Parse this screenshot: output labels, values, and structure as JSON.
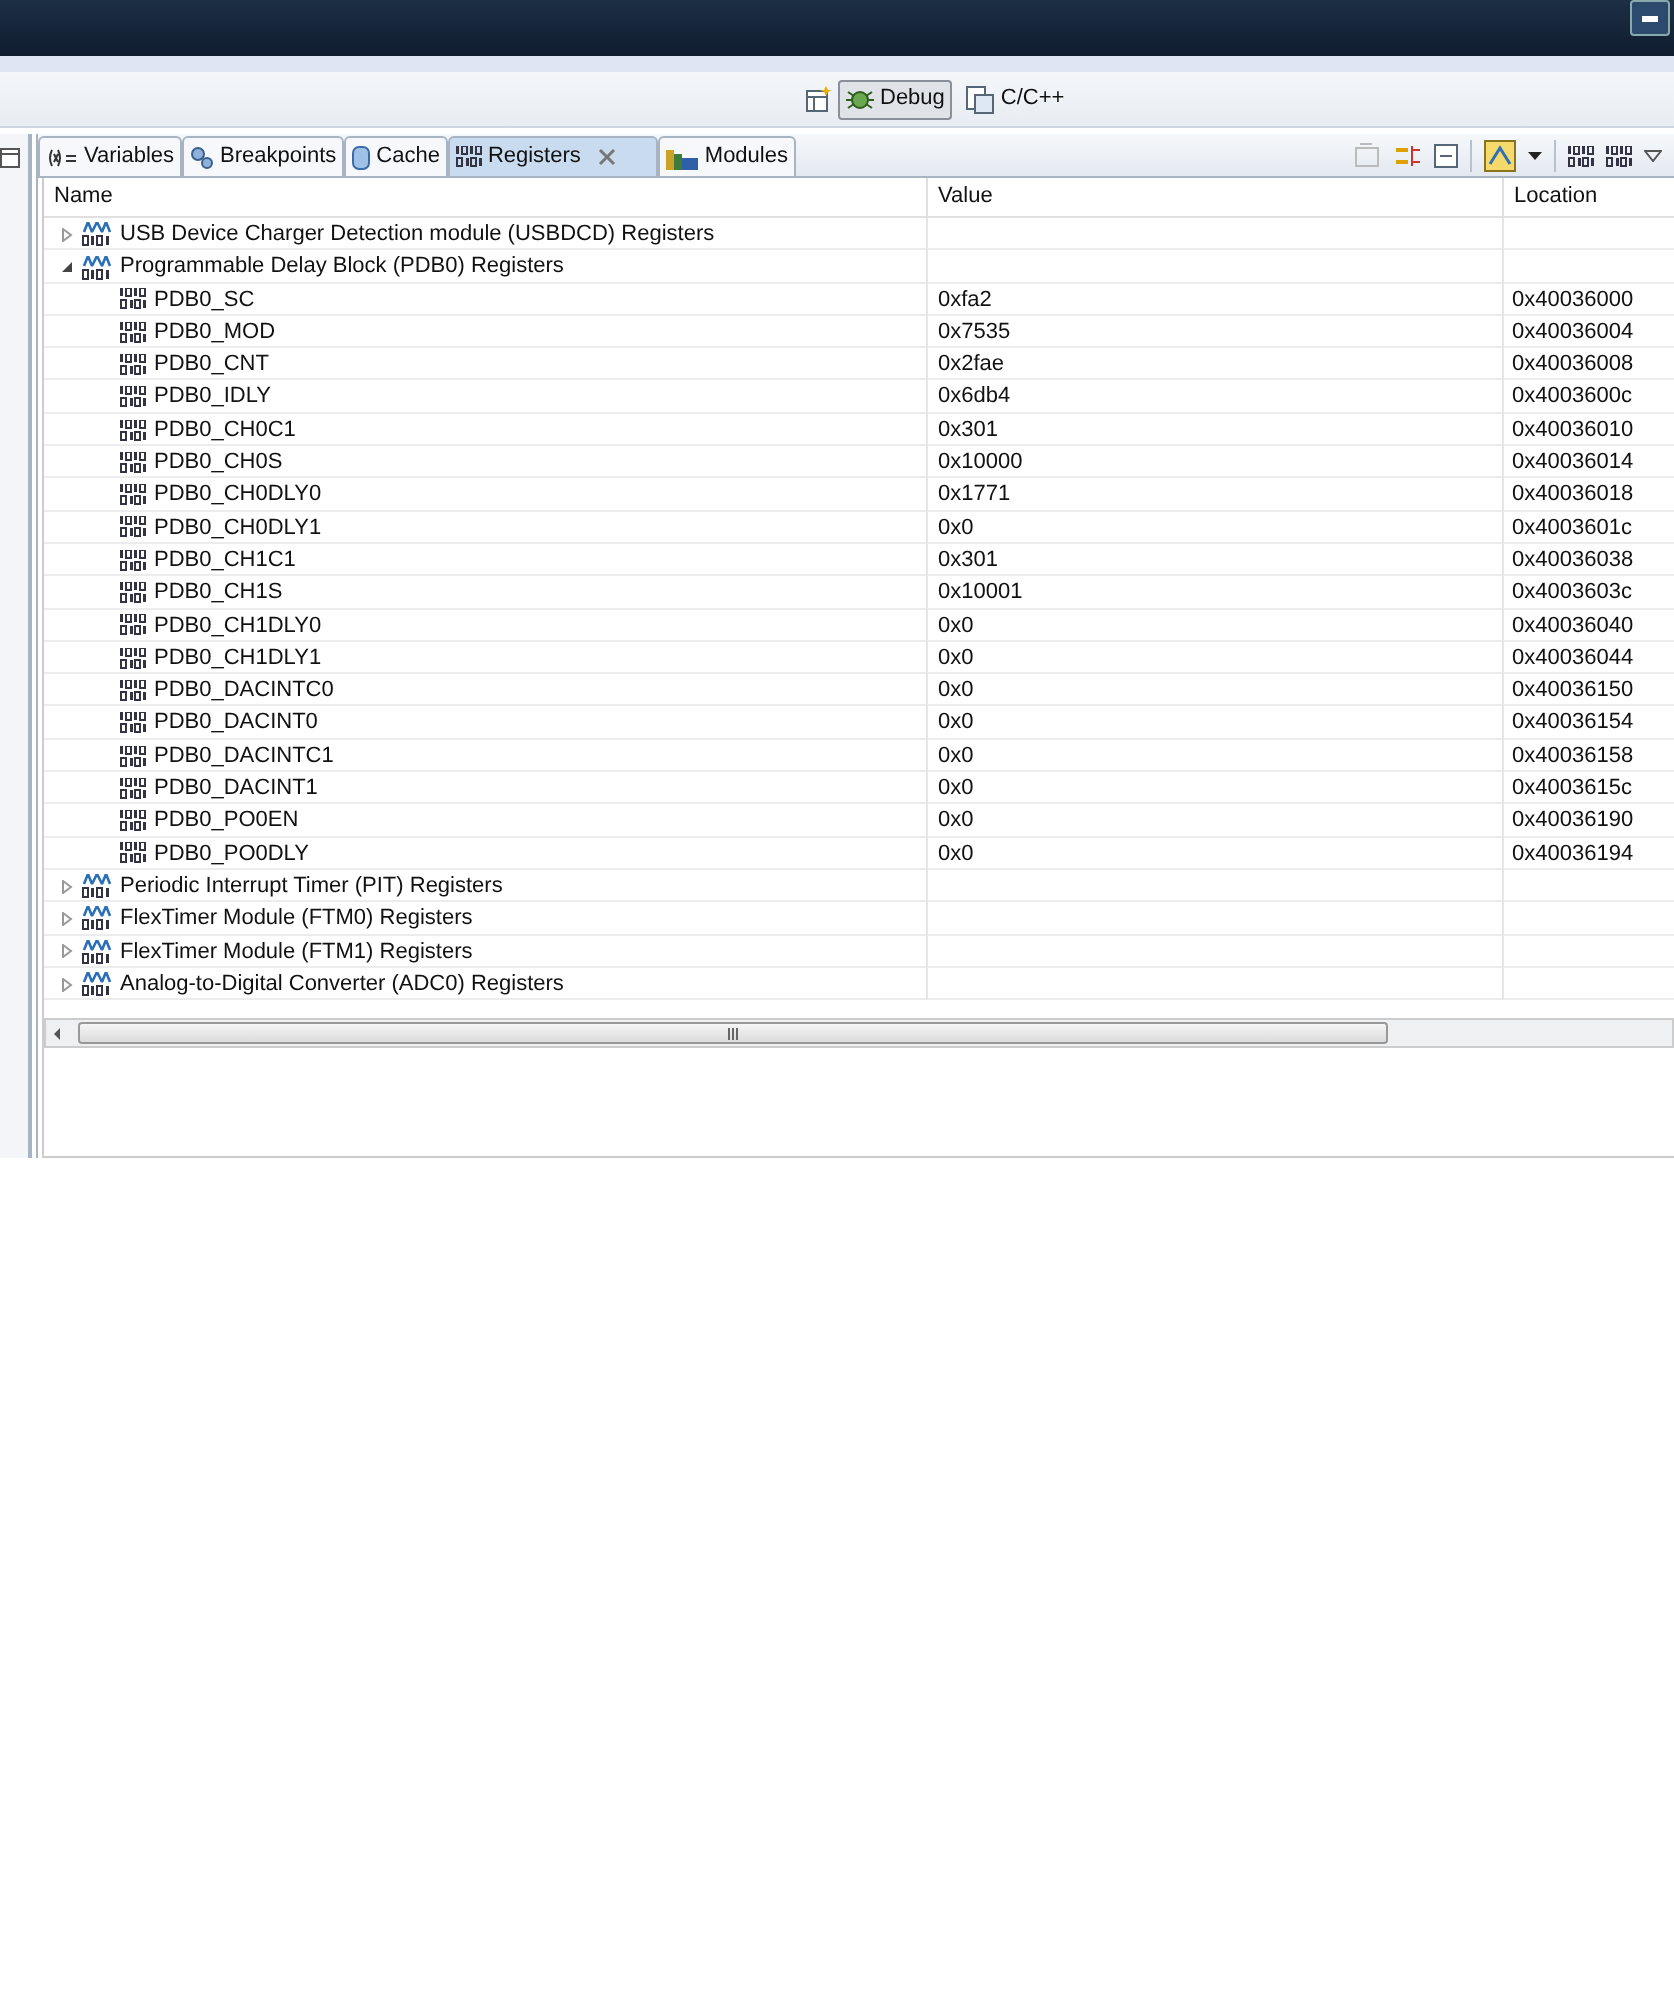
{
  "perspectives": [
    {
      "label": "Debug",
      "selected": true
    },
    {
      "label": "C/C++",
      "selected": false
    }
  ],
  "tabs": [
    {
      "label": "Variables",
      "kind": "variables",
      "selected": false,
      "closable": false
    },
    {
      "label": "Breakpoints",
      "kind": "breakpoints",
      "selected": false,
      "closable": false
    },
    {
      "label": "Cache",
      "kind": "cache",
      "selected": false,
      "closable": false
    },
    {
      "label": "Registers",
      "kind": "registers",
      "selected": true,
      "closable": true
    },
    {
      "label": "Modules",
      "kind": "modules",
      "selected": false,
      "closable": false
    }
  ],
  "table": {
    "columns": [
      "Name",
      "Value",
      "Location"
    ],
    "rows": [
      {
        "name": "USB Device Charger Detection module (USBDCD) Registers",
        "expanded": false
      },
      {
        "name": "Programmable Delay Block (PDB0) Registers",
        "expanded": true,
        "children": [
          {
            "name": "PDB0_SC",
            "value": "0xfa2",
            "location": "0x40036000"
          },
          {
            "name": "PDB0_MOD",
            "value": "0x7535",
            "location": "0x40036004"
          },
          {
            "name": "PDB0_CNT",
            "value": "0x2fae",
            "location": "0x40036008"
          },
          {
            "name": "PDB0_IDLY",
            "value": "0x6db4",
            "location": "0x4003600c"
          },
          {
            "name": "PDB0_CH0C1",
            "value": "0x301",
            "location": "0x40036010"
          },
          {
            "name": "PDB0_CH0S",
            "value": "0x10000",
            "location": "0x40036014"
          },
          {
            "name": "PDB0_CH0DLY0",
            "value": "0x1771",
            "location": "0x40036018"
          },
          {
            "name": "PDB0_CH0DLY1",
            "value": "0x0",
            "location": "0x4003601c"
          },
          {
            "name": "PDB0_CH1C1",
            "value": "0x301",
            "location": "0x40036038"
          },
          {
            "name": "PDB0_CH1S",
            "value": "0x10001",
            "location": "0x4003603c"
          },
          {
            "name": "PDB0_CH1DLY0",
            "value": "0x0",
            "location": "0x40036040"
          },
          {
            "name": "PDB0_CH1DLY1",
            "value": "0x0",
            "location": "0x40036044"
          },
          {
            "name": "PDB0_DACINTC0",
            "value": "0x0",
            "location": "0x40036150"
          },
          {
            "name": "PDB0_DACINT0",
            "value": "0x0",
            "location": "0x40036154"
          },
          {
            "name": "PDB0_DACINTC1",
            "value": "0x0",
            "location": "0x40036158"
          },
          {
            "name": "PDB0_DACINT1",
            "value": "0x0",
            "location": "0x4003615c"
          },
          {
            "name": "PDB0_PO0EN",
            "value": "0x0",
            "location": "0x40036190"
          },
          {
            "name": "PDB0_PO0DLY",
            "value": "0x0",
            "location": "0x40036194"
          }
        ]
      },
      {
        "name": "Periodic Interrupt Timer (PIT) Registers",
        "expanded": false
      },
      {
        "name": "FlexTimer Module (FTM0) Registers",
        "expanded": false
      },
      {
        "name": "FlexTimer Module (FTM1) Registers",
        "expanded": false
      },
      {
        "name": "Analog-to-Digital Converter (ADC0) Registers",
        "expanded": false
      }
    ]
  }
}
